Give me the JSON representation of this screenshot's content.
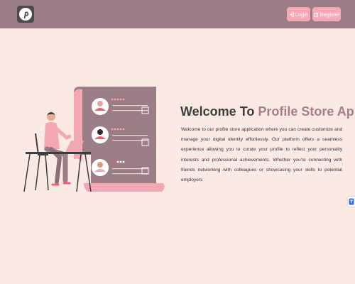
{
  "navbar": {
    "logo_icon": "pinterest-icon",
    "login_label": "Login",
    "login_icon": "sign-in-icon",
    "register_label": "Register",
    "register_icon": "edit-icon"
  },
  "hero": {
    "title_prefix": "Welcome To ",
    "title_accent": "Profile Store App",
    "description": "Welcome to our profile store application where you can create customize and manage your digital identity effortlessly. Our platform offers a seamless experience allowing you to curate your profile to reflect your personality interests and professional achievements. Whether you're connecting with friends networking with colleagues or showcasing your skills to potential employers"
  },
  "side_widget": {
    "icon": "translate-icon"
  },
  "colors": {
    "navbar": "#9b7d86",
    "background": "#fbeae3",
    "button": "#f4aab4",
    "accent": "#a57f85",
    "text": "#3d3d3d"
  }
}
